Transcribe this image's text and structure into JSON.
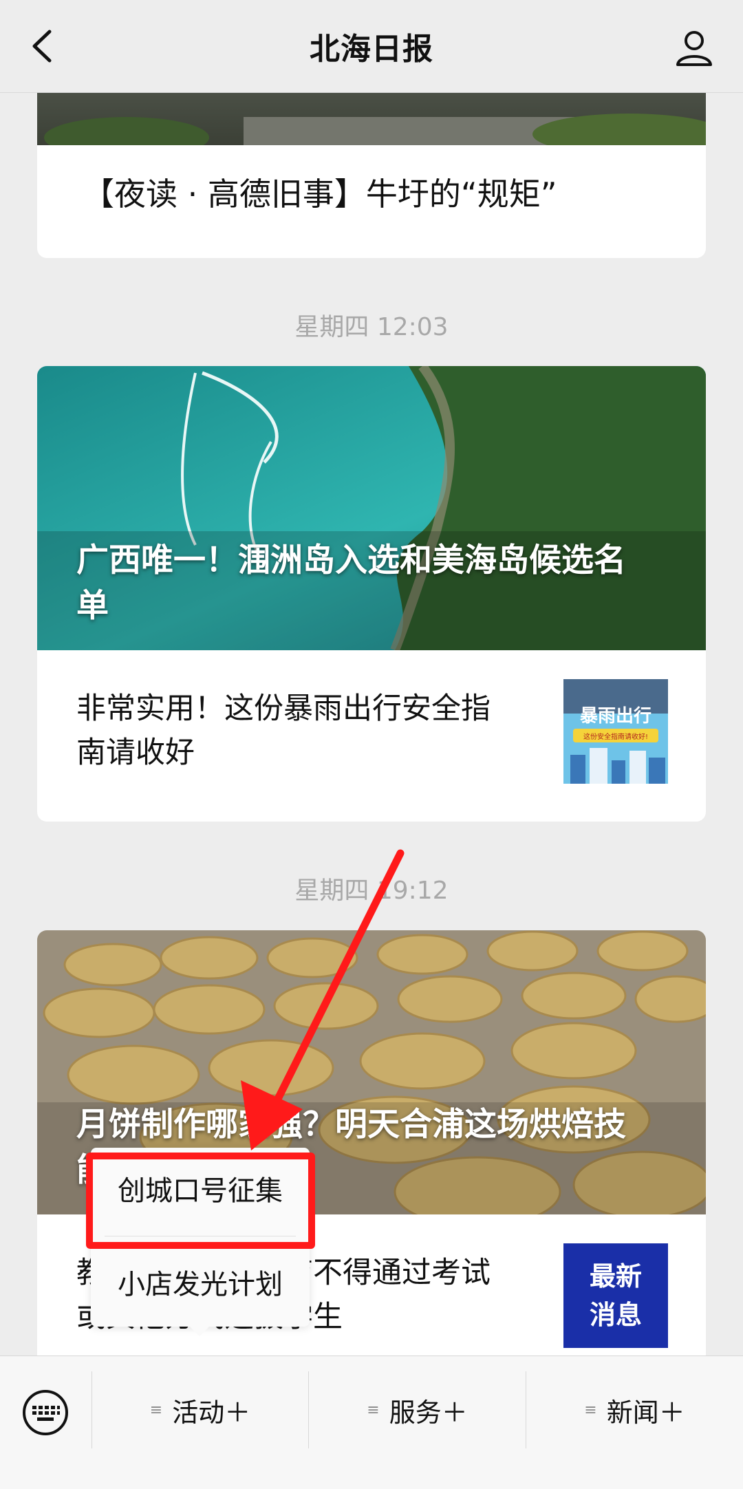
{
  "header": {
    "title": "北海日报"
  },
  "feed": {
    "prev_card_title": "【夜读 · 高德旧事】牛圩的“规矩”",
    "ts1": "星期四 12:03",
    "card1": {
      "hero_title": "广西唯一！涠洲岛入选和美海岛候选名单",
      "row_title": "非常实用！这份暴雨出行安全指南请收好",
      "thumb_text": "暴雨出行",
      "thumb_sub": "这份安全指南请收好!"
    },
    "ts2": "星期四 19:12",
    "card2": {
      "hero_title": "月饼制作哪家强？明天合浦这场烘焙技能赛不要错过",
      "row_title": "教育部：义务教育不得通过考试或其他方式选拔学生",
      "thumb_text": "最新消息"
    }
  },
  "popup": {
    "items": [
      "创城口号征集",
      "小店发光计划"
    ]
  },
  "bottom_menu": {
    "keyboard_icon": "keyboard-icon",
    "items": [
      "活动＋",
      "服务＋",
      "新闻＋"
    ]
  },
  "colors": {
    "highlight": "#ff1a1a",
    "background": "#ededed"
  }
}
